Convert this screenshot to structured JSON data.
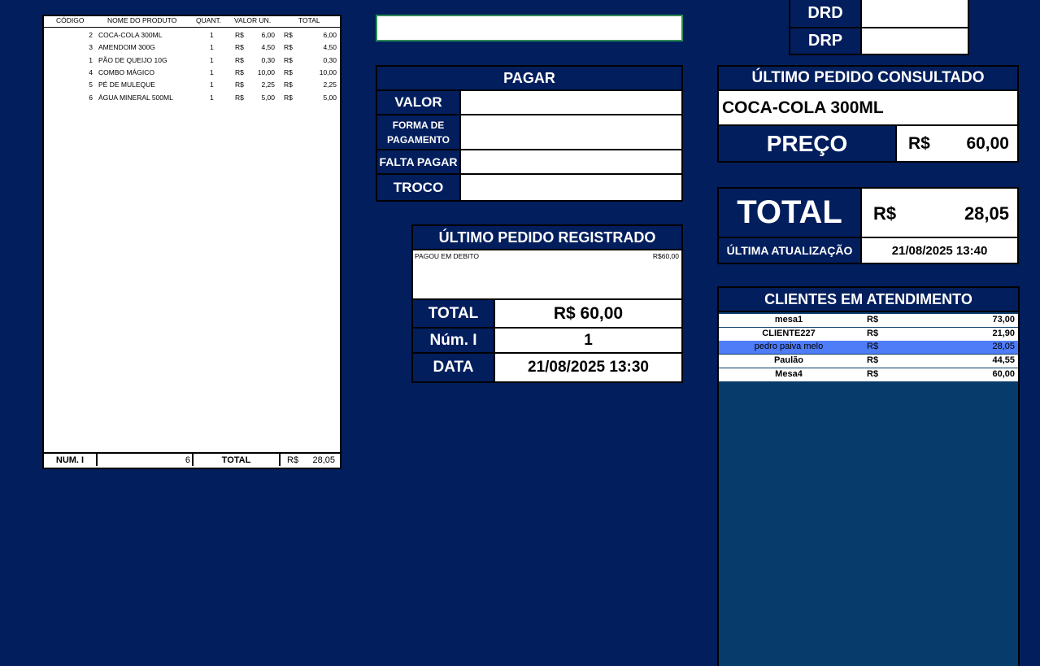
{
  "order_table": {
    "headers": [
      "CÓDIGO",
      "NOME DO PRODUTO",
      "QUANT.",
      "VALOR UN.",
      "TOTAL"
    ],
    "rows": [
      {
        "code": "2",
        "name": "COCA-COLA 300ML",
        "qty": "1",
        "cur1": "R$",
        "unit": "6,00",
        "cur2": "R$",
        "total": "6,00"
      },
      {
        "code": "3",
        "name": "AMENDOIM 300G",
        "qty": "1",
        "cur1": "R$",
        "unit": "4,50",
        "cur2": "R$",
        "total": "4,50"
      },
      {
        "code": "1",
        "name": "PÃO DE QUEIJO 10G",
        "qty": "1",
        "cur1": "R$",
        "unit": "0,30",
        "cur2": "R$",
        "total": "0,30"
      },
      {
        "code": "4",
        "name": "COMBO MÁGICO",
        "qty": "1",
        "cur1": "R$",
        "unit": "10,00",
        "cur2": "R$",
        "total": "10,00"
      },
      {
        "code": "5",
        "name": "PÉ DE MULEQUE",
        "qty": "1",
        "cur1": "R$",
        "unit": "2,25",
        "cur2": "R$",
        "total": "2,25"
      },
      {
        "code": "6",
        "name": "ÁGUA MINERAL 500ML",
        "qty": "1",
        "cur1": "R$",
        "unit": "5,00",
        "cur2": "R$",
        "total": "5,00"
      }
    ],
    "footer": {
      "num_label": "NUM. I",
      "num_value": "6",
      "total_label": "TOTAL",
      "currency": "R$",
      "total_value": "28,05"
    }
  },
  "search": {
    "value": ""
  },
  "pagar": {
    "title": "PAGAR",
    "valor_label": "VALOR",
    "forma_label": "FORMA DE PAGAMENTO",
    "falta_label": "FALTA PAGAR",
    "troco_label": "TROCO",
    "valor_value": "",
    "forma_value": "",
    "falta_value": "",
    "troco_value": ""
  },
  "registrado": {
    "title": "ÚLTIMO PEDIDO REGISTRADO",
    "note_left": "PAGOU EM  DEBITO",
    "note_right": "R$60,00",
    "total_label": "TOTAL",
    "total_value": "R$ 60,00",
    "num_label": "Núm. I",
    "num_value": "1",
    "data_label": "DATA",
    "data_value": "21/08/2025 13:30"
  },
  "drd": {
    "drd_label": "DRD",
    "drp_label": "DRP",
    "drd_value": "",
    "drp_value": ""
  },
  "consultado": {
    "title": "ÚLTIMO PEDIDO CONSULTADO",
    "product": "COCA-COLA 300ML",
    "preco_label": "PREÇO",
    "currency": "R$",
    "preco_value": "60,00"
  },
  "total_box": {
    "label": "TOTAL",
    "currency": "R$",
    "value": "28,05",
    "update_label": "ÚLTIMA ATUALIZAÇÃO",
    "update_value": "21/08/2025 13:40"
  },
  "clientes": {
    "title": "CLIENTES EM ATENDIMENTO",
    "rows": [
      {
        "name": "mesa1",
        "currency": "R$",
        "value": "73,00",
        "selected": false
      },
      {
        "name": "CLIENTE227",
        "currency": "R$",
        "value": "21,90",
        "selected": false
      },
      {
        "name": "pedro paiva melo",
        "currency": "R$",
        "value": "28,05",
        "selected": true
      },
      {
        "name": "Paulão",
        "currency": "R$",
        "value": "44,55",
        "selected": false
      },
      {
        "name": "Mesa4",
        "currency": "R$",
        "value": "60,00",
        "selected": false
      }
    ],
    "selected_color": "#4f7cf7"
  },
  "colors": {
    "background": "#021e5d",
    "list_empty": "#073b6b",
    "input_border": "#2e8b57"
  }
}
